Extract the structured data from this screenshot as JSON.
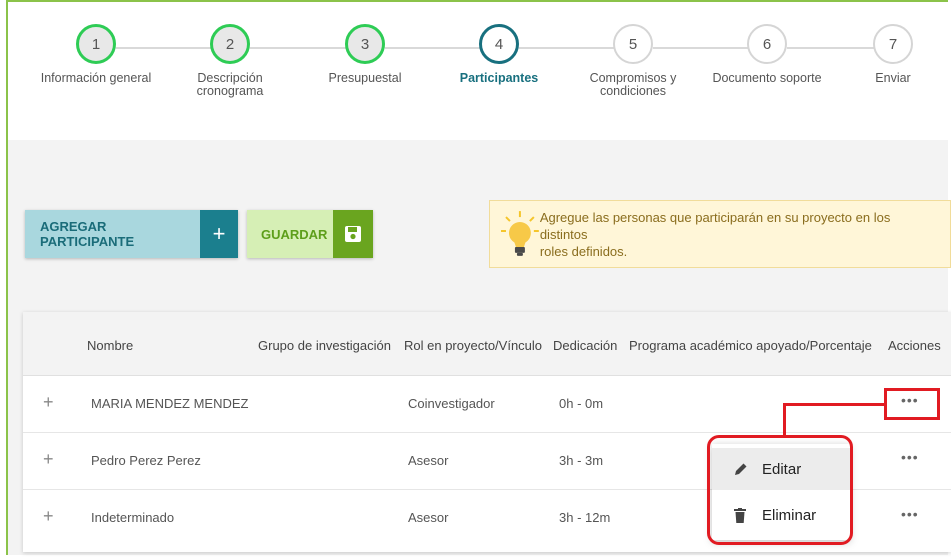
{
  "stepper": {
    "steps": [
      {
        "number": "1",
        "label": "Información general",
        "state": "done"
      },
      {
        "number": "2",
        "label_line1": "Descripción",
        "label_line2": "cronograma",
        "state": "done"
      },
      {
        "number": "3",
        "label": "Presupuestal",
        "state": "done"
      },
      {
        "number": "4",
        "label": "Participantes",
        "state": "active"
      },
      {
        "number": "5",
        "label_line1": "Compromisos y",
        "label_line2": "condiciones",
        "state": "todo"
      },
      {
        "number": "6",
        "label": "Documento soporte",
        "state": "todo"
      },
      {
        "number": "7",
        "label": "Enviar",
        "state": "todo"
      }
    ]
  },
  "actions": {
    "add_label": "AGREGAR PARTICIPANTE",
    "add_icon": "plus-icon",
    "save_label": "GUARDAR",
    "save_icon": "floppy-disk-icon"
  },
  "hint": {
    "icon": "lightbulb-icon",
    "line1": "Agregue las personas que participarán en su proyecto en los distintos",
    "line2": "roles definidos."
  },
  "table": {
    "columns": [
      "Nombre",
      "Grupo de investigación",
      "Rol en proyecto/Vínculo",
      "Dedicación",
      "Programa académico apoyado/Porcentaje",
      "Acciones"
    ],
    "rows": [
      {
        "expand": "+",
        "nombre": "MARIA MENDEZ MENDEZ",
        "grupo": "",
        "rol": "Coinvestigador",
        "dedicacion": "0h - 0m",
        "programa": "",
        "acciones": "•••"
      },
      {
        "expand": "+",
        "nombre": "Pedro Perez Perez",
        "grupo": "",
        "rol": "Asesor",
        "dedicacion": "3h - 3m",
        "programa": "",
        "acciones": "•••"
      },
      {
        "expand": "+",
        "nombre": "Indeterminado",
        "grupo": "",
        "rol": "Asesor",
        "dedicacion": "3h - 12m",
        "programa": "",
        "acciones": "•••"
      }
    ]
  },
  "context_menu": {
    "edit_label": "Editar",
    "edit_icon": "pencil-icon",
    "delete_label": "Eliminar",
    "delete_icon": "trash-icon"
  },
  "colors": {
    "done": "#2ecc55",
    "active": "#18707f",
    "annotation": "#e11b22"
  }
}
